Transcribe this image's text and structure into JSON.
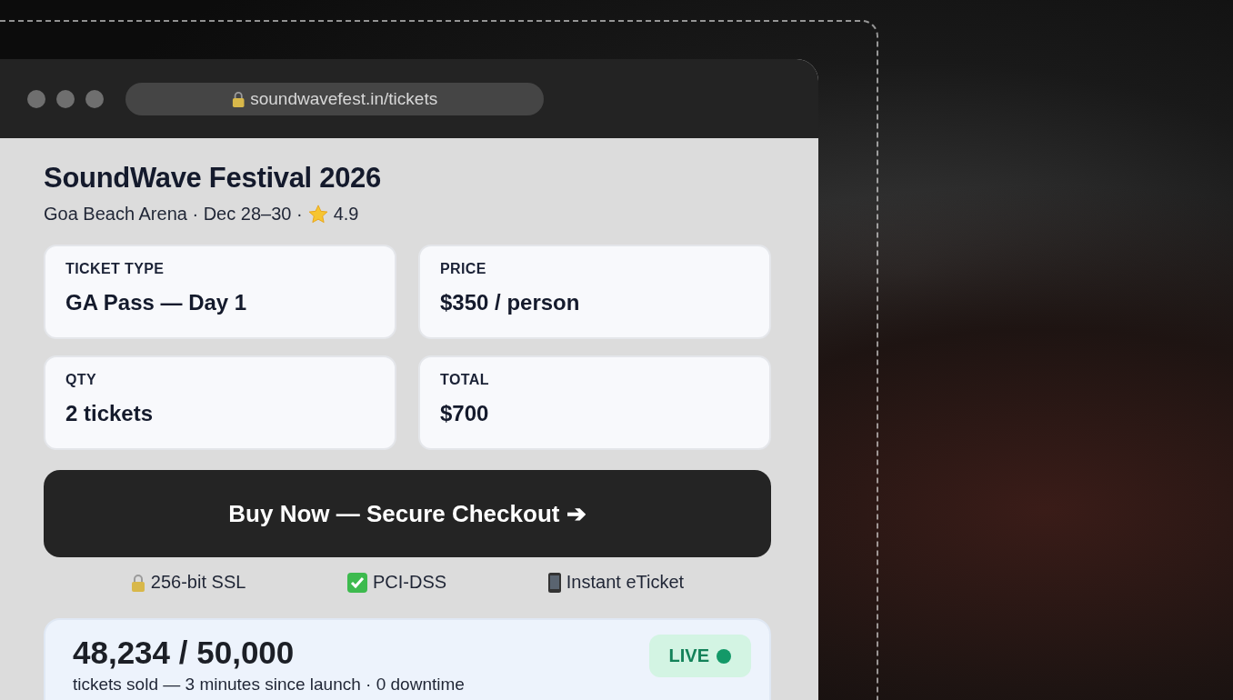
{
  "browser": {
    "url": "soundwavefest.in/tickets"
  },
  "event": {
    "title": "SoundWave Festival 2026",
    "venue": "Goa Beach Arena · Dec 28–30 ·",
    "rating": "4.9"
  },
  "fields": [
    {
      "label": "TICKET TYPE",
      "value": "GA Pass — Day 1"
    },
    {
      "label": "PRICE",
      "value": "$350 / person"
    },
    {
      "label": "QTY",
      "value": "2 tickets"
    },
    {
      "label": "TOTAL",
      "value": "$700"
    }
  ],
  "checkout_button": "Buy Now — Secure Checkout ➔",
  "trust_badges": [
    {
      "kind": "lock",
      "text": "256-bit SSL"
    },
    {
      "kind": "check",
      "text": "PCI-DSS"
    },
    {
      "kind": "phone",
      "text": "Instant eTicket"
    }
  ],
  "stats": {
    "count": "48,234 / 50,000",
    "caption": "tickets sold — 3 minutes since launch · 0 downtime",
    "status": "LIVE",
    "live": true
  }
}
